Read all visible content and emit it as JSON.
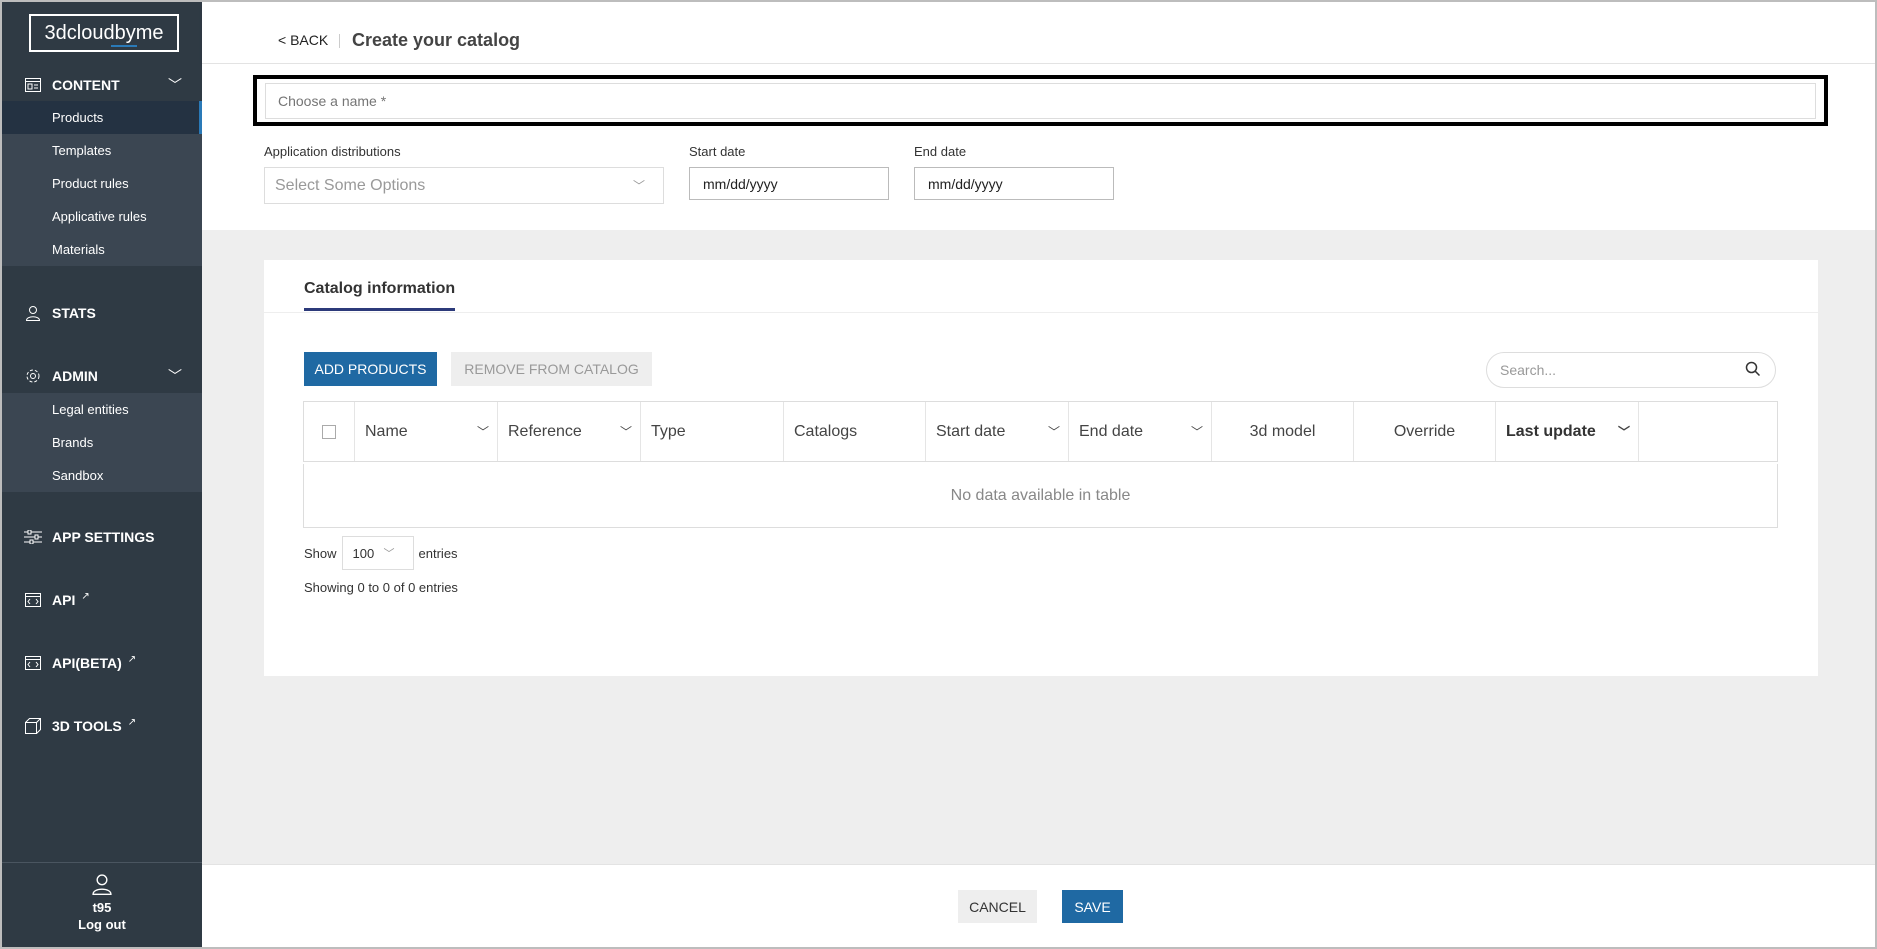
{
  "sidebar": {
    "logo": "3dcloudbyme",
    "sections": {
      "content": {
        "label": "CONTENT",
        "icon": "catalog-icon"
      },
      "stats": {
        "label": "STATS",
        "icon": "user-icon"
      },
      "admin": {
        "label": "ADMIN",
        "icon": "gear-icon"
      },
      "app_settings": {
        "label": "APP SETTINGS",
        "icon": "sliders-icon"
      },
      "api": {
        "label": "API",
        "icon": "code-window-icon"
      },
      "api_beta": {
        "label": "API(BETA)",
        "icon": "code-window-icon"
      },
      "tools": {
        "label": "3D TOOLS",
        "icon": "cube-icon"
      }
    },
    "content_items": [
      "Products",
      "Templates",
      "Product rules",
      "Applicative rules",
      "Materials"
    ],
    "admin_items": [
      "Legal entities",
      "Brands",
      "Sandbox"
    ],
    "user": {
      "name": "t95",
      "logout": "Log out"
    }
  },
  "header": {
    "back": "< BACK",
    "title": "Create your catalog"
  },
  "form": {
    "name_placeholder": "Choose a name *",
    "distributions_label": "Application distributions",
    "distributions_placeholder": "Select Some Options",
    "start_label": "Start date",
    "start_value": "mm/dd/yyyy",
    "end_label": "End date",
    "end_value": "mm/dd/yyyy"
  },
  "card": {
    "tab": "Catalog information",
    "add_button": "ADD PRODUCTS",
    "remove_button": "REMOVE FROM CATALOG",
    "search_placeholder": "Search...",
    "columns": [
      "Name",
      "Reference",
      "Type",
      "Catalogs",
      "Start date",
      "End date",
      "3d model",
      "Override",
      "Last update"
    ],
    "empty": "No data available in table",
    "show": "Show",
    "page_length": "100",
    "entries": "entries",
    "info": "Showing 0 to 0 of 0 entries"
  },
  "footer": {
    "cancel": "CANCEL",
    "save": "SAVE"
  },
  "colors": {
    "sidebar": "#2f3a44",
    "primary": "#1f69a3",
    "tab_underline": "#2c3a7a"
  }
}
